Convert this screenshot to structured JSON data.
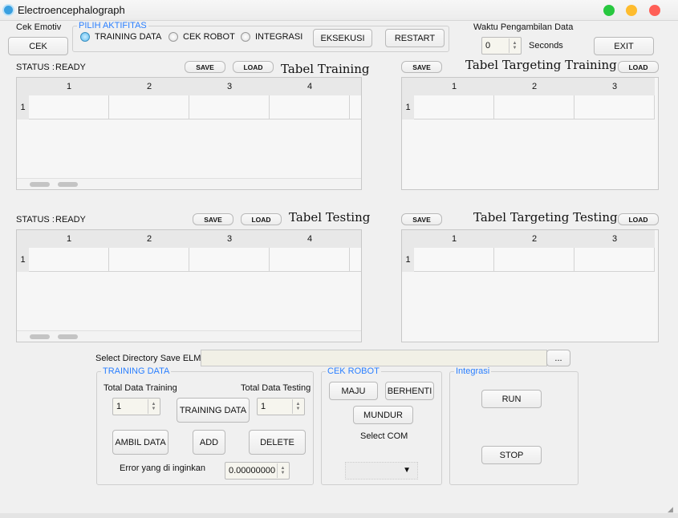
{
  "window": {
    "title": "Electroencephalograph",
    "controls": {
      "green": "#28c840",
      "yellow": "#febc2e",
      "red": "#ff5f57"
    }
  },
  "cek_emotiv": {
    "label": "Cek Emotiv",
    "button": "CEK"
  },
  "activity": {
    "legend": "PILIH AKTIFITAS",
    "options": [
      {
        "label": "TRAINING DATA",
        "selected": true
      },
      {
        "label": "CEK ROBOT",
        "selected": false
      },
      {
        "label": "INTEGRASI",
        "selected": false
      }
    ],
    "execute": "EKSEKUSI",
    "restart": "RESTART"
  },
  "timing": {
    "label": "Waktu Pengambilan Data",
    "value": "0",
    "unit": "Seconds",
    "exit": "EXIT"
  },
  "training_table": {
    "status_label": "STATUS :",
    "status": "READY",
    "save": "SAVE",
    "load": "LOAD",
    "title": "Tabel Training",
    "columns": [
      "1",
      "2",
      "3",
      "4"
    ],
    "rows": [
      "1"
    ]
  },
  "target_training_table": {
    "save": "SAVE",
    "load": "LOAD",
    "title": "Tabel Targeting Training",
    "columns": [
      "1",
      "2",
      "3"
    ],
    "rows": [
      "1"
    ]
  },
  "testing_table": {
    "status_label": "STATUS :",
    "status": "READY",
    "save": "SAVE",
    "load": "LOAD",
    "title": "Tabel Testing",
    "columns": [
      "1",
      "2",
      "3",
      "4"
    ],
    "rows": [
      "1"
    ]
  },
  "target_testing_table": {
    "save": "SAVE",
    "load": "LOAD",
    "title": "Tabel Targeting Testing",
    "columns": [
      "1",
      "2",
      "3"
    ],
    "rows": [
      "1"
    ]
  },
  "directory": {
    "label": "Select Directory Save ELM",
    "value": "",
    "browse": "..."
  },
  "training_data": {
    "legend": "TRAINING DATA",
    "total_training_label": "Total Data Training",
    "total_training": "1",
    "total_testing_label": "Total Data Testing",
    "total_testing": "1",
    "training_button": "TRAINING DATA",
    "ambil": "AMBIL DATA",
    "add": "ADD",
    "delete": "DELETE",
    "error_label": "Error yang di inginkan",
    "error_value": "0.00000000"
  },
  "cek_robot": {
    "legend": "CEK ROBOT",
    "maju": "MAJU",
    "berhenti": "BERHENTI",
    "mundur": "MUNDUR",
    "com_label": "Select COM",
    "com_value": ""
  },
  "integrasi": {
    "legend": "Integrasi",
    "run": "RUN",
    "stop": "STOP"
  }
}
